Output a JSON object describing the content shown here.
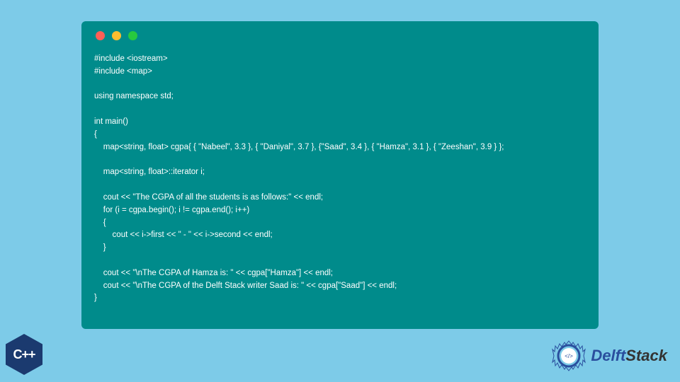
{
  "code": {
    "line1": "#include <iostream>",
    "line2": "#include <map>",
    "line3": "",
    "line4": "using namespace std;",
    "line5": "",
    "line6": "int main()",
    "line7": "{",
    "line8": "    map<string, float> cgpa{ { \"Nabeel\", 3.3 }, { \"Daniyal\", 3.7 }, {\"Saad\", 3.4 }, { \"Hamza\", 3.1 }, { \"Zeeshan\", 3.9 } };",
    "line9": "",
    "line10": "    map<string, float>::iterator i;",
    "line11": "",
    "line12": "    cout << \"The CGPA of all the students is as follows:\" << endl;",
    "line13": "    for (i = cgpa.begin(); i != cgpa.end(); i++)",
    "line14": "    {",
    "line15": "        cout << i->first << \" - \" << i->second << endl;",
    "line16": "    }",
    "line17": "",
    "line18": "    cout << \"\\nThe CGPA of Hamza is: \" << cgpa[\"Hamza\"] << endl;",
    "line19": "    cout << \"\\nThe CGPA of the Delft Stack writer Saad is: \" << cgpa[\"Saad\"] << endl;",
    "line20": "}"
  },
  "cpp_badge": "C++",
  "brand": {
    "name1": "Delft",
    "name2": "Stack"
  }
}
